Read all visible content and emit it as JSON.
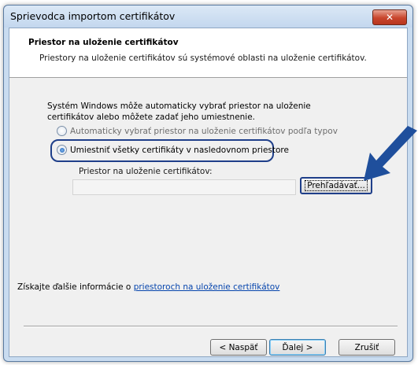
{
  "window": {
    "title": "Sprievodca importom certifikátov",
    "close_glyph": "✕"
  },
  "header": {
    "title": "Priestor na uloženie certifikátov",
    "subtitle": "Priestory na uloženie certifikátov sú systémové oblasti na uloženie certifikátov."
  },
  "body": {
    "description": "Systém Windows môže automaticky vybrať priestor na uloženie certifikátov alebo môžete zadať jeho umiestnenie.",
    "radio_auto": "Automaticky vybrať priestor na uloženie certifikátov podľa typov",
    "radio_manual": "Umiestniť všetky certifikáty v nasledovnom priestore",
    "selected_option": "radio_manual",
    "store_label": "Priestor na uloženie certifikátov:",
    "store_value": "",
    "browse_label": "Prehľadávať..."
  },
  "info": {
    "prefix": "Získajte ďalšie informácie o ",
    "link": "priestoroch na uloženie certifikátov"
  },
  "buttons": {
    "back": "< Naspäť",
    "next": "Ďalej >",
    "cancel": "Zrušiť"
  },
  "colors": {
    "annotation_arrow": "#1f4f9c",
    "annotation_outline": "#1f3f8a"
  }
}
